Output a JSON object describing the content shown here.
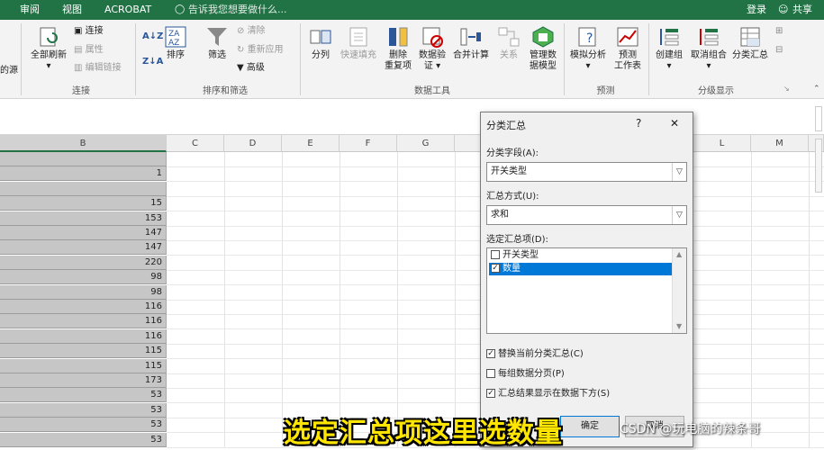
{
  "tabs": {
    "review": "审阅",
    "view": "视图",
    "acrobat": "ACROBAT",
    "tell_me": "告诉我您想要做什么...",
    "login": "登录",
    "share": "共享"
  },
  "ribbon": {
    "cut_left": "的源",
    "connections_group": {
      "refresh_all": "全部刷新",
      "connections": "连接",
      "properties": "属性",
      "edit_links": "编辑链接",
      "label": "连接"
    },
    "sort_filter_group": {
      "sort_az": "A↓Z",
      "sort_za": "Z↓A",
      "sort": "排序",
      "filter": "筛选",
      "clear": "清除",
      "reapply": "重新应用",
      "advanced": "高级",
      "label": "排序和筛选"
    },
    "data_tools_group": {
      "text_to_columns": "分列",
      "flash_fill": "快速填充",
      "remove_dup_1": "删除",
      "remove_dup_2": "重复项",
      "validation_1": "数据验",
      "validation_2": "证",
      "consolidate": "合并计算",
      "relationships": "关系",
      "manage_model_1": "管理数",
      "manage_model_2": "据模型",
      "label": "数据工具"
    },
    "forecast_group": {
      "what_if": "模拟分析",
      "forecast_1": "预测",
      "forecast_2": "工作表",
      "label": "预测"
    },
    "outline_group": {
      "group": "创建组",
      "ungroup": "取消组合",
      "subtotal": "分类汇总",
      "label": "分级显示"
    }
  },
  "sheet": {
    "columns": [
      "B",
      "C",
      "D",
      "E",
      "F",
      "G",
      "L",
      "M"
    ],
    "b_values": [
      "",
      "1",
      "",
      "15",
      "153",
      "147",
      "147",
      "220",
      "98",
      "98",
      "116",
      "116",
      "116",
      "115",
      "115",
      "173",
      "53",
      "53",
      "53",
      "53"
    ]
  },
  "dialog": {
    "title": "分类汇总",
    "help": "?",
    "close": "✕",
    "field_label": "分类字段(A):",
    "field_value": "开关类型",
    "func_label": "汇总方式(U):",
    "func_value": "求和",
    "items_label": "选定汇总项(D):",
    "items": [
      {
        "label": "开关类型",
        "checked": false
      },
      {
        "label": "数量",
        "checked": true
      }
    ],
    "opt_replace": "替换当前分类汇总(C)",
    "opt_pagebreak": "每组数据分页(P)",
    "opt_below": "汇总结果显示在数据下方(S)",
    "ok": "确定",
    "cancel": "取消"
  },
  "overlay": {
    "subtitle": "选定汇总项这里选数量",
    "watermark": "CSDN @玩电脑的辣条哥"
  }
}
